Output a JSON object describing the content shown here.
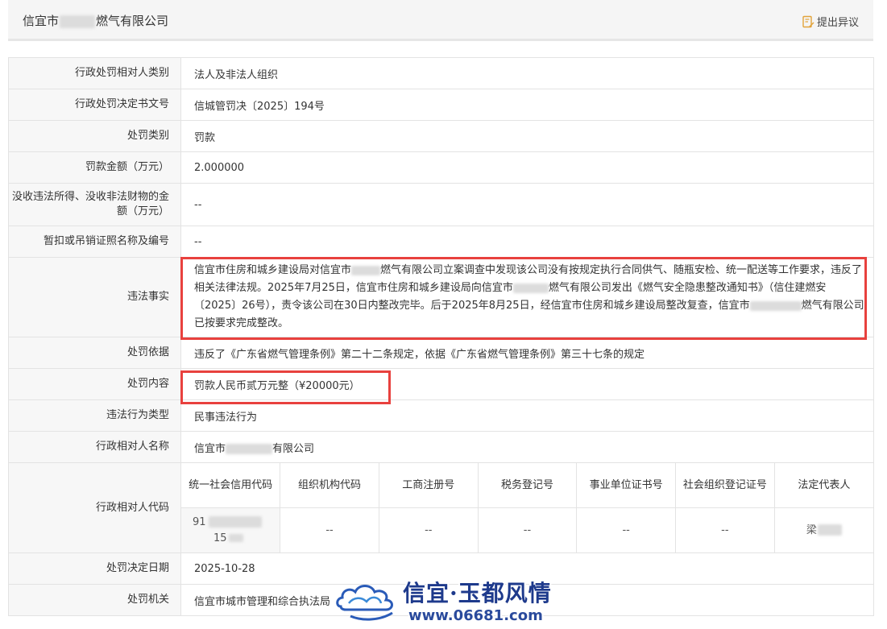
{
  "header": {
    "company_prefix": "信宜市",
    "company_suffix": "燃气有限公司",
    "objection_label": "提出异议"
  },
  "rows": [
    {
      "label": "行政处罚相对人类别",
      "value": "法人及非法人组织"
    },
    {
      "label": "行政处罚决定书文号",
      "value": "信城管罚决〔2025〕194号"
    },
    {
      "label": "处罚类别",
      "value": "罚款"
    },
    {
      "label": "罚款金额（万元）",
      "value": "2.000000"
    },
    {
      "label": "没收违法所得、没收非法财物的金额（万元）",
      "value": "--"
    },
    {
      "label": "暂扣或吊销证照名称及编号",
      "value": "--"
    }
  ],
  "violation": {
    "label": "违法事实",
    "part1": "信宜市住房和城乡建设局对信宜市",
    "part2": "燃气有限公司立案调查中发现该公司没有按规定执行合同供气、随瓶安检、统一配送等工作要求，违反了相关法律法规。2025年7月25日，信宜市住房和城乡建设局向信宜市",
    "part3": "燃气有限公司发出《燃气安全隐患整改通知书》（信住建燃安〔2025〕26号），责令该公司在30日内整改完毕。后于2025年8月25日，经信宜市住房和城乡建设局整改复查，信宜市",
    "part4": "燃气有限公司已按要求完成整改。"
  },
  "basis": {
    "label": "处罚依据",
    "value": "违反了《广东省燃气管理条例》第二十二条规定，依据《广东省燃气管理条例》第三十七条的规定"
  },
  "content": {
    "label": "处罚内容",
    "value": "罚款人民币贰万元整（¥20000元）"
  },
  "behavior_type": {
    "label": "违法行为类型",
    "value": "民事违法行为"
  },
  "party_name": {
    "label": "行政相对人名称",
    "prefix": "信宜市",
    "suffix": "有限公司"
  },
  "party_code": {
    "label": "行政相对人代码",
    "headers": [
      "统一社会信用代码",
      "组织机构代码",
      "工商注册号",
      "税务登记号",
      "事业单位证书号",
      "社会组织登记证号",
      "法定代表人"
    ],
    "credit_code_line1": "91",
    "credit_code_line2": "15",
    "org_code": "--",
    "biz_reg": "--",
    "tax_reg": "--",
    "inst_cert": "--",
    "social_org": "--",
    "legal_rep": "梁"
  },
  "decision_date": {
    "label": "处罚决定日期",
    "value": "2025-10-28"
  },
  "authority": {
    "label": "处罚机关",
    "value": "信宜市城市管理和综合执法局"
  },
  "watermark": {
    "title": "信宜·玉都风情",
    "url": "www.06681.com"
  },
  "colors": {
    "highlight": "#e8413e",
    "label_bg": "#f7f7f7",
    "border": "#e3e3e3"
  }
}
